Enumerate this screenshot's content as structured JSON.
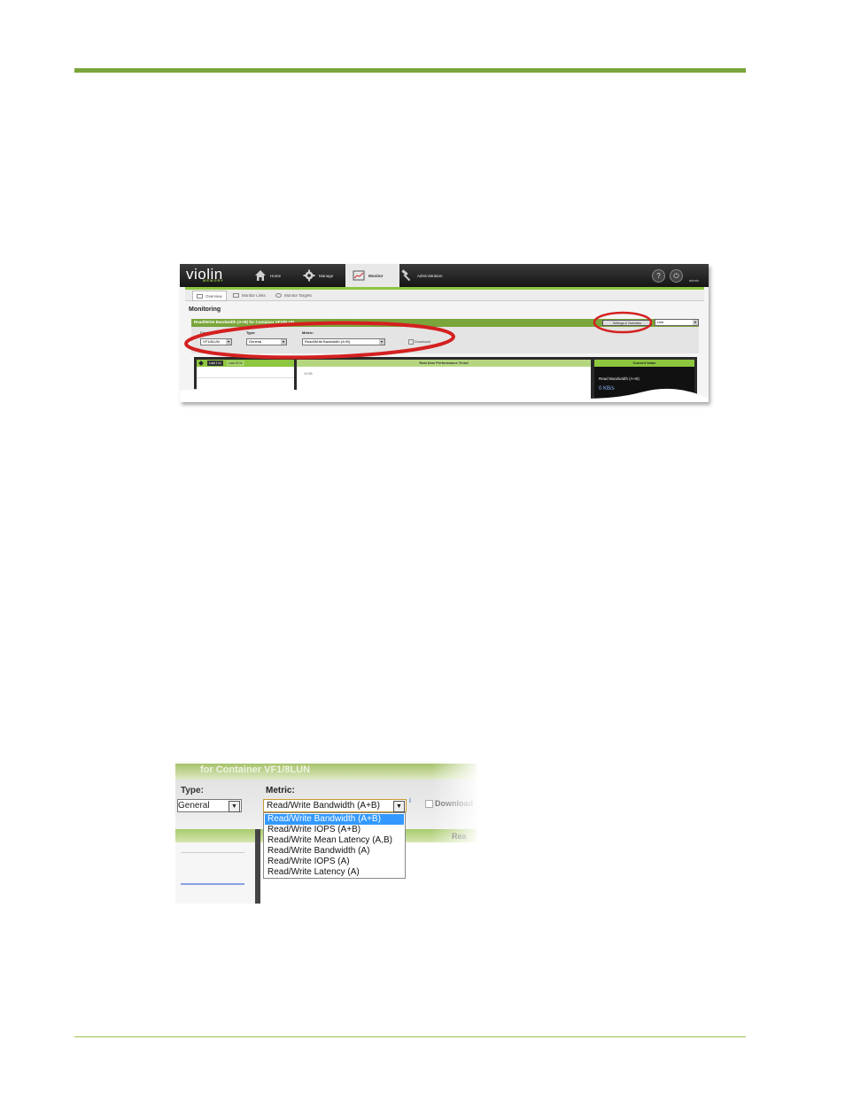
{
  "shot1": {
    "logo": "violin",
    "logo_sub": "MEMORY",
    "nav": {
      "home": "Home",
      "manage": "Manage",
      "monitor": "Monitor",
      "administration": "Administration"
    },
    "user": "admin",
    "subtabs": {
      "overview": "Overview",
      "monitor_links": "Monitor Links",
      "monitor_targets": "Monitor Targets"
    },
    "page_title": "Monitoring",
    "panel_title": "Read/Write Bandwidth (A+B) for Container VF1/8LUN",
    "settings_button": "Settings & Overrides",
    "link_select": "Link",
    "filters": {
      "container_label": "Container:",
      "container_value": "VF1/8LUN",
      "type_label": "Type:",
      "type_value": "General",
      "metric_label": "Metric:",
      "metric_value": "Read/Write Bandwidth (A+B)",
      "download_label": "Download"
    },
    "chart": {
      "tab_a": "Last 1 hr",
      "tab_b": "Last 24 hr",
      "center_title": "Real time Performance Trend",
      "y_label": "10 KB",
      "current_title": "Current Value",
      "current_label": "Read Bandwidth (A+B)",
      "current_value": "0 KB/s"
    }
  },
  "shot2": {
    "title": "for Container VF1/8LUN",
    "type_label": "Type:",
    "type_value": "General",
    "metric_label": "Metric:",
    "metric_value": "Read/Write Bandwidth (A+B)",
    "info_marker": "i",
    "download_label": "Download",
    "right_header": "Rea",
    "options": [
      "Read/Write Bandwidth (A+B)",
      "Read/Write IOPS (A+B)",
      "Read/Write Mean Latency (A,B)",
      "Read/Write Bandwidth (A)",
      "Read/Write IOPS (A)",
      "Read/Write Latency (A)"
    ]
  },
  "colors": {
    "accent_green": "#7aa53a",
    "annotation_red": "#d42020",
    "selection_blue": "#3399ff"
  }
}
